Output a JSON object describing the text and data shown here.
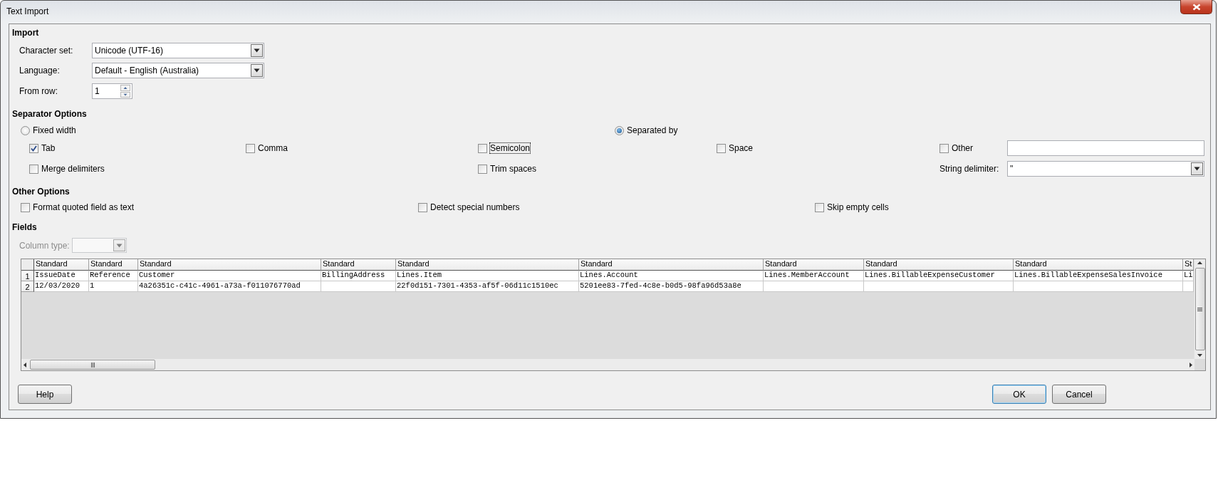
{
  "window": {
    "title": "Text Import"
  },
  "import": {
    "title": "Import",
    "character_set": {
      "label": "Character set:",
      "value": "Unicode (UTF-16)"
    },
    "language": {
      "label": "Language:",
      "value": "Default - English (Australia)"
    },
    "from_row": {
      "label": "From row:",
      "value": "1"
    }
  },
  "separator_options": {
    "title": "Separator Options",
    "modes": [
      {
        "label": "Fixed width",
        "selected": false
      },
      {
        "label": "Separated by",
        "selected": true
      }
    ],
    "delimiters": [
      {
        "label": "Tab",
        "checked": true,
        "focused": false
      },
      {
        "label": "Comma",
        "checked": false,
        "focused": false
      },
      {
        "label": "Semicolon",
        "checked": false,
        "focused": true
      },
      {
        "label": "Space",
        "checked": false,
        "focused": false
      },
      {
        "label": "Other",
        "checked": false,
        "focused": false
      }
    ],
    "merge_delimiters": {
      "label": "Merge delimiters",
      "checked": false
    },
    "trim_spaces": {
      "label": "Trim spaces",
      "checked": false
    },
    "string_delimiter": {
      "label": "String delimiter:",
      "value": "\""
    }
  },
  "other_options": {
    "title": "Other Options",
    "items": [
      {
        "label": "Format quoted field as text",
        "checked": false
      },
      {
        "label": "Detect special numbers",
        "checked": false
      },
      {
        "label": "Skip empty cells",
        "checked": false
      }
    ]
  },
  "fields": {
    "title": "Fields",
    "column_type": {
      "label": "Column type:",
      "disabled": true
    },
    "table": {
      "columns": [
        "Standard",
        "Standard",
        "Standard",
        "Standard",
        "Standard",
        "Standard",
        "Standard",
        "Standard",
        "Standard",
        "St"
      ],
      "rows": [
        {
          "number": "1",
          "cells": [
            "IssueDate",
            "Reference",
            "Customer",
            "BillingAddress",
            "Lines.Item",
            "Lines.Account",
            "Lines.MemberAccount",
            "Lines.BillableExpenseCustomer",
            "Lines.BillableExpenseSalesInvoice",
            "Li"
          ]
        },
        {
          "number": "2",
          "cells": [
            "12/03/2020",
            "1",
            "4a26351c-c41c-4961-a73a-f011076770ad",
            null,
            "22f0d151-7301-4353-af5f-06d11c1510ec",
            "5201ee83-7fed-4c8e-b0d5-98fa96d53a8e",
            null,
            null,
            null,
            null
          ]
        }
      ]
    }
  },
  "buttons": [
    {
      "label": "Help",
      "default": false
    },
    {
      "label": "OK",
      "default": true
    },
    {
      "label": "Cancel",
      "default": false
    }
  ]
}
